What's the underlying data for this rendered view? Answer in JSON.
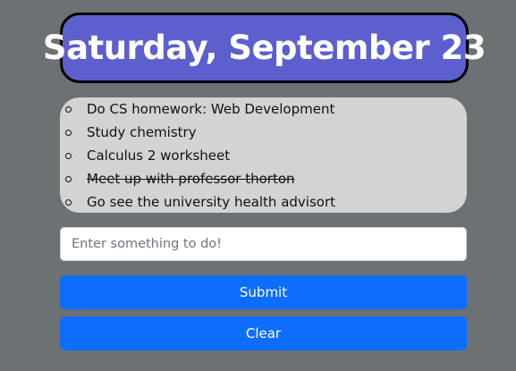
{
  "header": {
    "date": "Saturday, September 23"
  },
  "todos": [
    {
      "text": "Do CS homework: Web Development",
      "done": false
    },
    {
      "text": "Study chemistry",
      "done": false
    },
    {
      "text": "Calculus 2 worksheet",
      "done": false
    },
    {
      "text": "Meet up with professor thorton",
      "done": true
    },
    {
      "text": "Go see the university health advisort",
      "done": false
    }
  ],
  "input": {
    "placeholder": "Enter something to do!",
    "value": ""
  },
  "buttons": {
    "submit_label": "Submit",
    "clear_label": "Clear"
  },
  "colors": {
    "page_background": "#6c7174",
    "header_background": "#5c5fcd",
    "list_background": "#d3d3d3",
    "button_primary": "#0d6efd"
  }
}
